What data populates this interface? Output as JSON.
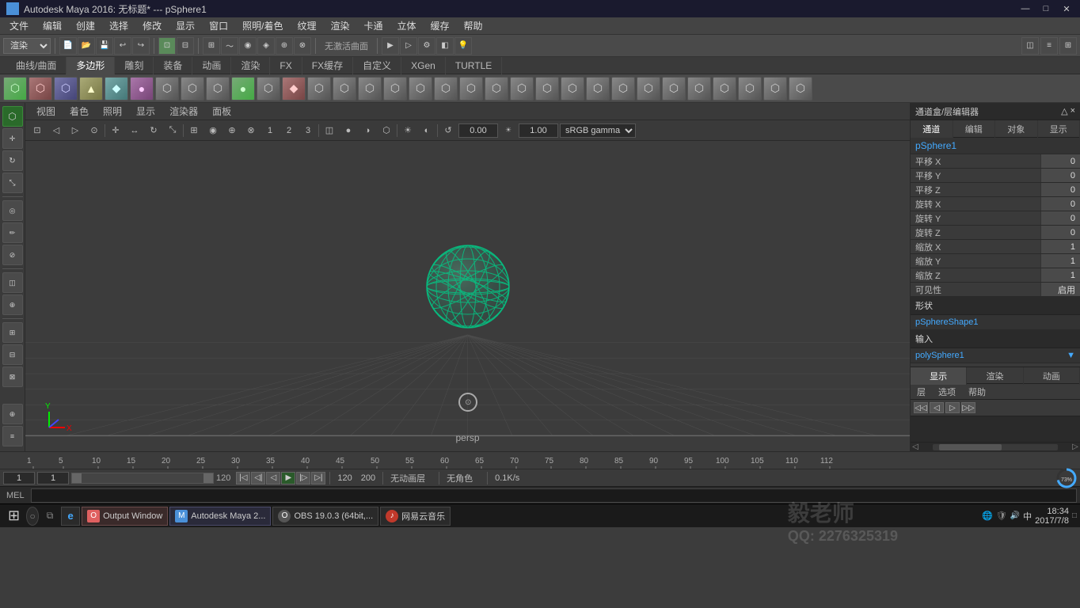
{
  "titlebar": {
    "title": "Autodesk Maya 2016: 无标题* --- pSphere1",
    "minimize": "—",
    "maximize": "□",
    "close": "✕"
  },
  "menubar": {
    "items": [
      "文件",
      "编辑",
      "创建",
      "选择",
      "修改",
      "显示",
      "窗口",
      "照明/着色",
      "纹理",
      "渲染",
      "卡通",
      "立体",
      "缓存",
      "帮助"
    ]
  },
  "toolbar1": {
    "dropdown": "渲染",
    "label_inactive": "无激活曲面"
  },
  "shelf_tabs": {
    "items": [
      "曲线/曲面",
      "多边形",
      "雕刻",
      "装备",
      "动画",
      "渲染",
      "FX",
      "FX缓存",
      "自定义",
      "XGen",
      "TURTLE"
    ]
  },
  "shelf_icons": {
    "items": [
      "⬡",
      "⬡",
      "⬡",
      "▲",
      "◆",
      "●",
      "⬡",
      "⬡",
      "⬡",
      "●",
      "⬡",
      "◆",
      "⬡",
      "⬡",
      "⬡",
      "⬡",
      "⬡",
      "⬡",
      "⬡",
      "⬡",
      "⬡",
      "⬡",
      "⬡",
      "⬡",
      "⬡",
      "⬡",
      "⬡",
      "⬡",
      "⬡",
      "⬡",
      "⬡",
      "⬡"
    ]
  },
  "viewport": {
    "menu": [
      "视图",
      "着色",
      "照明",
      "显示",
      "渲染器",
      "面板"
    ],
    "persp_label": "persp",
    "value1": "0.00",
    "value2": "1.00",
    "color_space": "sRGB gamma"
  },
  "channel_box": {
    "header": "通道盒/层编辑器",
    "tabs": [
      "通道",
      "编辑",
      "对象",
      "显示"
    ],
    "node_name": "pSphere1",
    "attributes": [
      {
        "label": "平移 X",
        "value": "0"
      },
      {
        "label": "平移 Y",
        "value": "0"
      },
      {
        "label": "平移 Z",
        "value": "0"
      },
      {
        "label": "旋转 X",
        "value": "0"
      },
      {
        "label": "旋转 Y",
        "value": "0"
      },
      {
        "label": "旋转 Z",
        "value": "0"
      },
      {
        "label": "缩放 X",
        "value": "1"
      },
      {
        "label": "缩放 Y",
        "value": "1"
      },
      {
        "label": "缩放 Z",
        "value": "1"
      },
      {
        "label": "可见性",
        "value": "启用"
      }
    ],
    "shape_label": "形状",
    "shape_name": "pSphereShape1",
    "input_label": "输入",
    "input_name": "polySphere1",
    "attr_tabs": [
      "显示",
      "渲染",
      "动画"
    ],
    "attr_subtabs": [
      "层",
      "选项",
      "帮助"
    ]
  },
  "timeline": {
    "start": "1",
    "end": "120",
    "current_start": "1",
    "current_end": "120",
    "range_end": "200",
    "ticks": [
      "1",
      "5",
      "10",
      "15",
      "20",
      "25",
      "30",
      "35",
      "40",
      "45",
      "50",
      "55",
      "60",
      "65",
      "70",
      "75",
      "80",
      "85",
      "90",
      "95",
      "100",
      "105",
      "110",
      "112"
    ]
  },
  "transport": {
    "frame_start": "1",
    "frame_current": "1",
    "frame_marker": "1",
    "anim_label": "无动画层",
    "angle_label": "无角色",
    "fps_label": "0.1K/s",
    "percent": "73%"
  },
  "cmdline": {
    "mode": "MEL",
    "placeholder": ""
  },
  "taskbar": {
    "start_icon": "⊞",
    "items": [
      {
        "icon": "●",
        "label": "Output Window",
        "color": "#e06060"
      },
      {
        "icon": "M",
        "label": "Autodesk Maya 2...",
        "color": "#4a90d9"
      },
      {
        "icon": "O",
        "label": "OBS 19.0.3 (64bit,...",
        "color": "#333"
      },
      {
        "icon": "♪",
        "label": "网易云音乐",
        "color": "#c0392b"
      }
    ],
    "clock": "18:34",
    "date": "2017/7/8",
    "qq_text": "QQ:  2276325319"
  },
  "watermark": {
    "line1": "毅老师",
    "line2": "QQ:  2276325319"
  }
}
